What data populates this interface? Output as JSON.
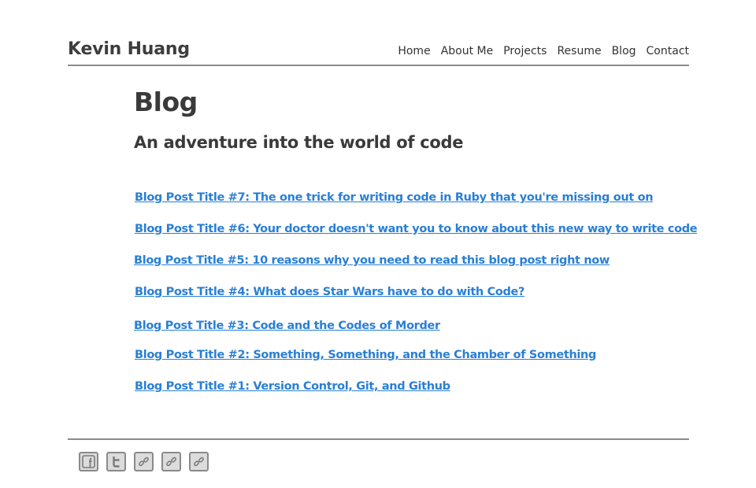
{
  "header": {
    "site_title": "Kevin Huang",
    "nav": [
      "Home",
      "About Me",
      "Projects",
      "Resume",
      "Blog",
      "Contact"
    ]
  },
  "main": {
    "title": "Blog",
    "subtitle": "An adventure into the world of code"
  },
  "posts": [
    "Blog Post Title #7: The one trick for writing code in Ruby that you're missing out on",
    "Blog Post Title #6: Your doctor doesn't want you to know about this new way to write code",
    "Blog Post Title #5: 10 reasons why you need to read this blog post right now",
    "Blog Post Title #4: What does Star Wars have to do with Code?",
    "Blog Post Title #3: Code and the Codes of Morder",
    "Blog Post Title #2: Something, Something, and the Chamber of Something",
    "Blog Post Title #1: Version Control, Git, and Github"
  ],
  "footer": {
    "social_icons": [
      "facebook-icon",
      "twitter-icon",
      "link-icon",
      "link-icon",
      "link-icon"
    ]
  },
  "colors": {
    "link": "#2a7fd4",
    "text": "#3a3a3a",
    "rule": "#8c8c8c"
  }
}
